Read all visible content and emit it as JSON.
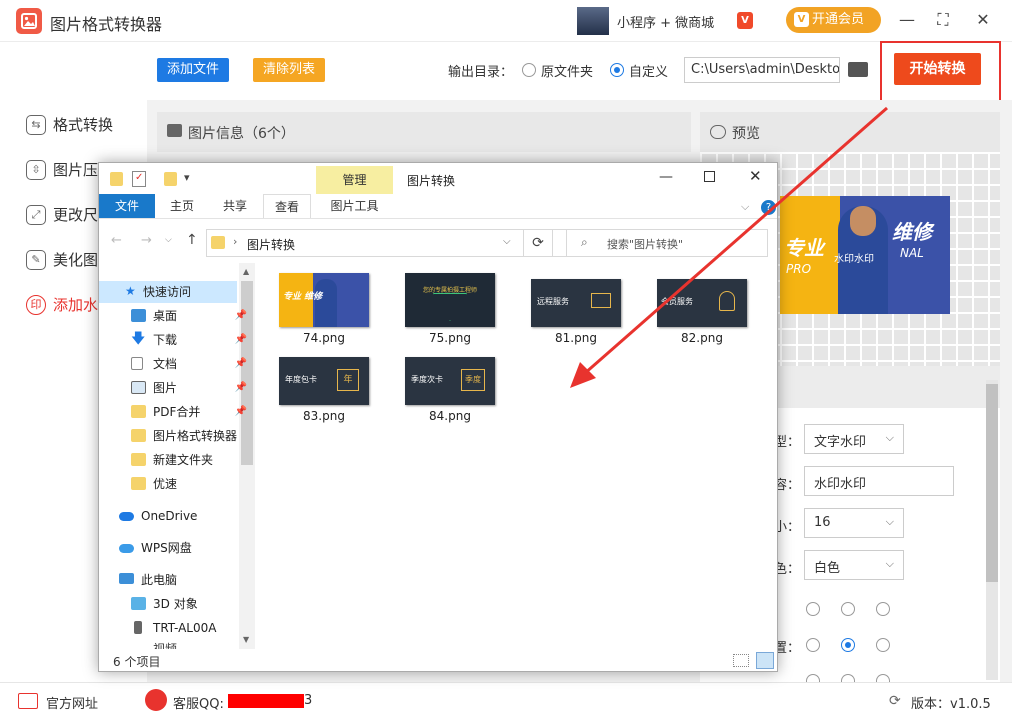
{
  "app": {
    "title": "图片格式转换器",
    "user_name": "小程序 + 微商城",
    "vip_mark": "V",
    "vip_button": "开通会员",
    "vip_icon": "V"
  },
  "window": {
    "minimize": "—",
    "maximize": "⛶",
    "close": "✕"
  },
  "sidebar": {
    "items": [
      {
        "label": "格式转换",
        "icon": "⇆"
      },
      {
        "label": "图片压",
        "icon": "⇳"
      },
      {
        "label": "更改尺",
        "icon": "⤢"
      },
      {
        "label": "美化图",
        "icon": "✎"
      },
      {
        "label": "添加水",
        "icon": "印",
        "active": true
      }
    ]
  },
  "toolbar": {
    "add_files": "添加文件",
    "clear_list": "清除列表",
    "output_label": "输出目录：",
    "radio_original": "原文件夹",
    "radio_custom": "自定义",
    "output_path": "C:\\Users\\admin\\Deskto",
    "start_button": "开始转换"
  },
  "panel": {
    "info_title": "图片信息（6个）",
    "preview_title": "预览"
  },
  "preview_image_text": {
    "left": "专业",
    "right": "维修",
    "sub": "PRO",
    "sub2": "NAL",
    "badge": "水印水印"
  },
  "settings": {
    "type_label": "型：",
    "type_value": "文字水印",
    "content_label": "容：",
    "content_value": "水印水印",
    "size_label": "小：",
    "size_value": "16",
    "color_label": "色：",
    "color_value": "白色",
    "position_label": "置："
  },
  "footer": {
    "website": "官方网址",
    "qq_label": "客服QQ:",
    "qq_tail": "3",
    "version": "版本：v1.0.5"
  },
  "explorer": {
    "title": "图片转换",
    "ribbon_manage": "管理",
    "tab_file": "文件",
    "tab_home": "主页",
    "tab_share": "共享",
    "tab_view": "查看",
    "tab_picture_tools": "图片工具",
    "address": "图片转换",
    "search_placeholder": "搜索\"图片转换\"",
    "nav": [
      {
        "label": "快速访问",
        "pin": false,
        "selected": true
      },
      {
        "label": "桌面",
        "pin": true
      },
      {
        "label": "下载",
        "pin": true
      },
      {
        "label": "文档",
        "pin": true
      },
      {
        "label": "图片",
        "pin": true
      },
      {
        "label": "PDF合并",
        "pin": true
      },
      {
        "label": "图片格式转换器",
        "pin": false
      },
      {
        "label": "新建文件夹",
        "pin": false
      },
      {
        "label": "优速",
        "pin": false
      },
      {
        "label": "OneDrive",
        "pin": false
      },
      {
        "label": "WPS网盘",
        "pin": false
      },
      {
        "label": "此电脑",
        "pin": false
      },
      {
        "label": "3D 对象",
        "pin": false
      },
      {
        "label": "TRT-AL00A",
        "pin": false
      },
      {
        "label": "视频",
        "pin": false
      }
    ],
    "files": [
      {
        "name": "74.png",
        "thumb_text": "专业  维修"
      },
      {
        "name": "75.png",
        "thumb_text": "您的专属拍摄工程师"
      },
      {
        "name": "81.png",
        "thumb_text": "远程服务"
      },
      {
        "name": "82.png",
        "thumb_text": "会员服务"
      },
      {
        "name": "83.png",
        "thumb_text": "年度包卡",
        "thumb_badge": "年"
      },
      {
        "name": "84.png",
        "thumb_text": "季度次卡",
        "thumb_badge": "季度"
      }
    ],
    "status": "6 个项目"
  },
  "colors": {
    "accent_blue": "#1e7ae3",
    "start_red": "#ee4a1c",
    "clear_orange": "#f5a623",
    "arrow_red": "#e8332e",
    "vip_gold": "#f2a324"
  }
}
